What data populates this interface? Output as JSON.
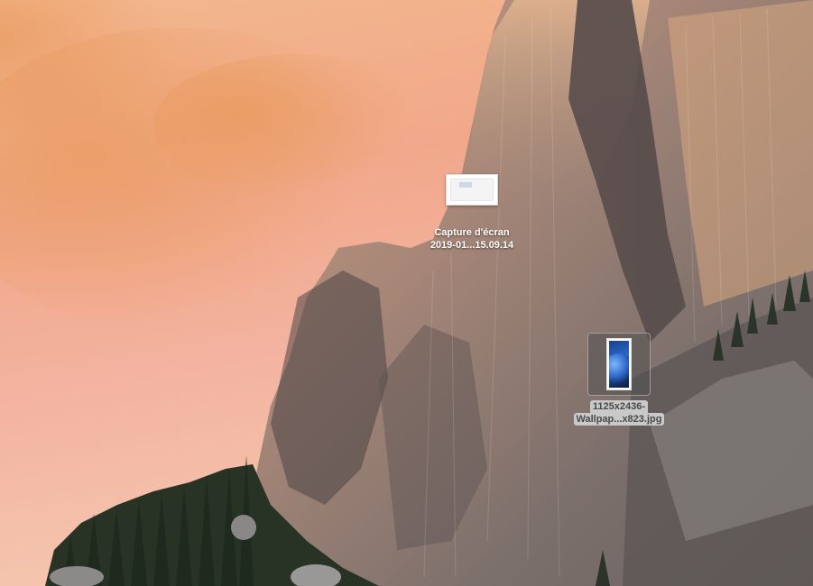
{
  "desktop": {
    "wallpaper": "Yosemite El Capitan sunset",
    "icons": [
      {
        "kind": "screenshot",
        "line1": "Capture d'écran",
        "line2": "2019-01...15.09.14",
        "selected": false
      },
      {
        "kind": "image",
        "line1": "1125x2436-",
        "line2": "Wallpap...x823.jpg",
        "selected": true
      }
    ]
  },
  "colors": {
    "sky": "#f1a88a",
    "rock": "#7b6e6b",
    "forest": "#2f3a2c",
    "selection_label_bg": "#c9c9c9"
  }
}
